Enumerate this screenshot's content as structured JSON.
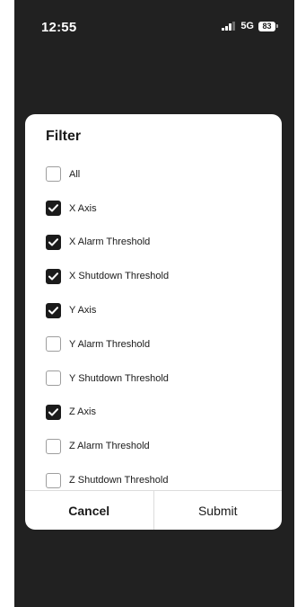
{
  "status_bar": {
    "time": "12:55",
    "network": "5G",
    "battery": "83"
  },
  "dialog": {
    "title": "Filter",
    "options": [
      {
        "label": "All",
        "checked": false
      },
      {
        "label": "X Axis",
        "checked": true
      },
      {
        "label": "X Alarm Threshold",
        "checked": true
      },
      {
        "label": "X Shutdown Threshold",
        "checked": true
      },
      {
        "label": "Y Axis",
        "checked": true
      },
      {
        "label": "Y Alarm Threshold",
        "checked": false
      },
      {
        "label": "Y Shutdown Threshold",
        "checked": false
      },
      {
        "label": "Z Axis",
        "checked": true
      },
      {
        "label": "Z Alarm Threshold",
        "checked": false
      },
      {
        "label": "Z Shutdown Threshold",
        "checked": false
      }
    ],
    "cancel_label": "Cancel",
    "submit_label": "Submit"
  },
  "icons": {
    "checkbox": "checkbox-icon",
    "check": "checkmark-icon",
    "signal": "signal-icon",
    "battery": "battery-icon"
  },
  "colors": {
    "background": "#212121",
    "dialog": "#ffffff",
    "checked": "#1b1b1b",
    "unchecked_border": "#9e9e9e",
    "divider": "#dcdcdc"
  }
}
